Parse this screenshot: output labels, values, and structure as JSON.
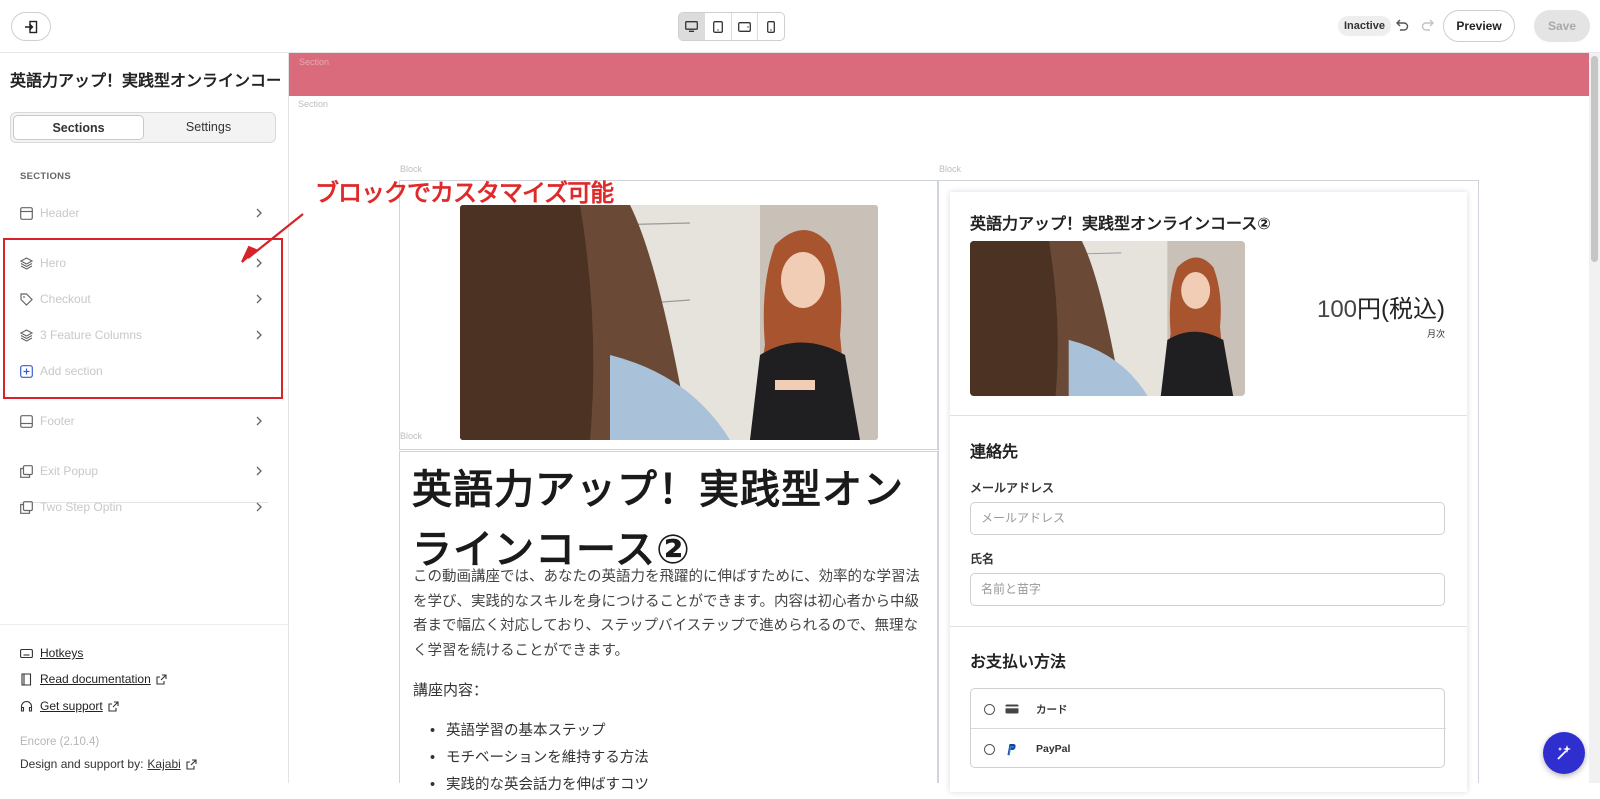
{
  "topbar": {
    "status": "Inactive",
    "preview_label": "Preview",
    "save_label": "Save",
    "devices": [
      "desktop-icon",
      "tablet-icon",
      "tablet-landscape-icon",
      "mobile-icon"
    ]
  },
  "sidebar": {
    "title": "英語力アップ！実践型オンラインコー...",
    "tabs": [
      {
        "label": "Sections"
      },
      {
        "label": "Settings"
      }
    ],
    "section_heading": "SECTIONS",
    "items": [
      {
        "label": "Header",
        "icon": "header-icon"
      },
      {
        "label": "Hero",
        "icon": "layers-icon"
      },
      {
        "label": "Checkout",
        "icon": "tag-icon"
      },
      {
        "label": "3 Feature Columns",
        "icon": "layers-icon"
      },
      {
        "label": "Add section",
        "icon": "add-icon"
      },
      {
        "label": "Footer",
        "icon": "footer-icon"
      },
      {
        "label": "Exit Popup",
        "icon": "popup-icon"
      },
      {
        "label": "Two Step Optin",
        "icon": "popup-icon"
      }
    ],
    "footer_links": [
      {
        "label": "Hotkeys",
        "icon": "keyboard-icon"
      },
      {
        "label": "Read documentation",
        "icon": "book-icon"
      },
      {
        "label": "Get support",
        "icon": "headset-icon"
      }
    ],
    "version": "Encore (2.10.4)",
    "credit_prefix": "Design and support by:",
    "credit_link": "Kajabi"
  },
  "annotation": {
    "text": "ブロックでカスタマイズ可能",
    "color": "#e02a2a"
  },
  "canvas": {
    "section_label": "Section",
    "block_label": "Block",
    "band_color": "#d96b7d"
  },
  "hero": {
    "title": "英語力アップ！実践型オンラインコース②",
    "description": "この動画講座では、あなたの英語力を飛躍的に伸ばすために、効率的な学習法を学び、実践的なスキルを身につけることができます。内容は初心者から中級者まで幅広く対応しており、ステップバイステップで進められるので、無理なく学習を続けることができます。",
    "course_label": "講座内容：",
    "bullets": [
      "英語学習の基本ステップ",
      "モチベーションを維持する方法",
      "実践的な英会話力を伸ばすコツ"
    ]
  },
  "checkout": {
    "title": "英語力アップ！実践型オンラインコース②",
    "price_number": "100",
    "price_unit": "円(税込)",
    "period": "月次",
    "contact_heading": "連絡先",
    "email_label": "メールアドレス",
    "email_placeholder": "メールアドレス",
    "name_label": "氏名",
    "name_placeholder": "名前と苗字",
    "payment_heading": "お支払い方法",
    "payment_options": [
      {
        "label": "カード",
        "icon": "card-icon"
      },
      {
        "label": "PayPal",
        "icon": "paypal-icon"
      }
    ]
  },
  "colors": {
    "accent": "#2f2fd0",
    "annotation_red": "#d8232a"
  }
}
